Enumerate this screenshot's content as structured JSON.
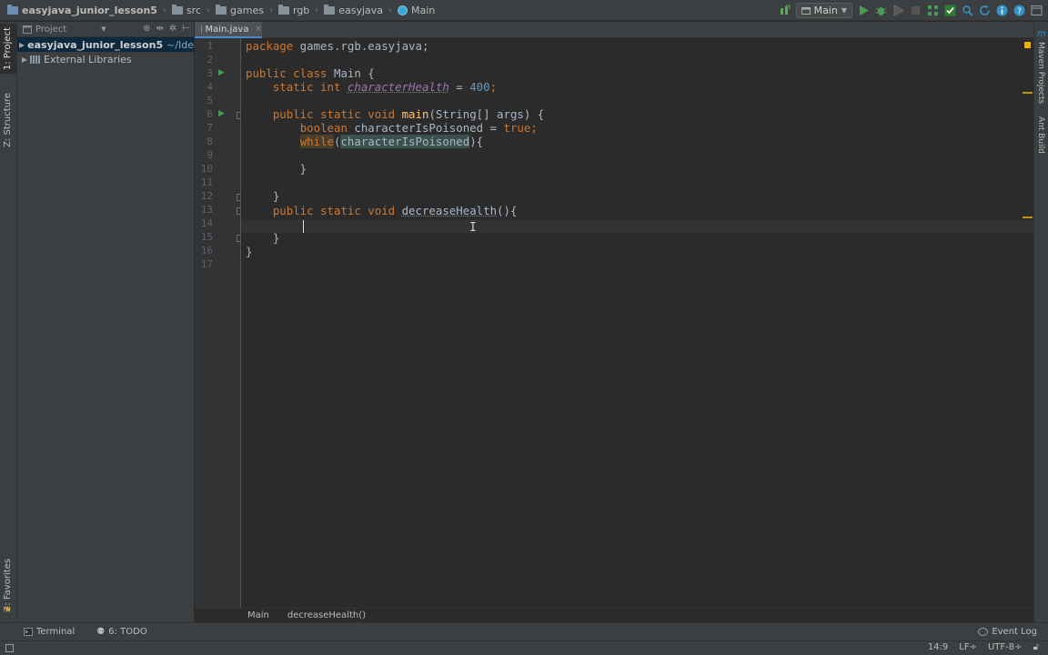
{
  "navbar": {
    "breadcrumbs": [
      {
        "label": "easyjava_junior_lesson5",
        "icon": "project-folder-icon"
      },
      {
        "label": "src",
        "icon": "folder-icon"
      },
      {
        "label": "games",
        "icon": "folder-icon"
      },
      {
        "label": "rgb",
        "icon": "folder-icon"
      },
      {
        "label": "easyjava",
        "icon": "folder-icon"
      },
      {
        "label": "Main",
        "icon": "class-icon"
      }
    ],
    "run_config": "Main"
  },
  "left_strip": {
    "tabs": [
      "1: Project",
      "Z: Structure",
      "2: Favorites"
    ]
  },
  "project_panel": {
    "header": "Project",
    "tree": [
      {
        "label": "easyjava_junior_lesson5",
        "path": "~/Idea",
        "expanded": false
      },
      {
        "label": "External Libraries",
        "expanded": false
      }
    ]
  },
  "editor": {
    "tab": "Main.java",
    "line_numbers": [
      "1",
      "2",
      "3",
      "4",
      "5",
      "6",
      "7",
      "8",
      "9",
      "10",
      "11",
      "12",
      "13",
      "14",
      "15",
      "16",
      "17"
    ],
    "code": {
      "l1_kw": "package",
      "l1_rest": " games.rgb.easyjava;",
      "l3_kw": "public class",
      "l3_rest": " Main {",
      "l4_indent": "    ",
      "l4_kw": "static int",
      "l4_space": " ",
      "l4_field": "characterHealth",
      "l4_eq": " = ",
      "l4_num": "400",
      "l4_semi": ";",
      "l6_indent": "    ",
      "l6_kw": "public static void",
      "l6_space": " ",
      "l6_method": "main",
      "l6_rest": "(String[] args) {",
      "l7_indent": "        ",
      "l7_kw": "boolean",
      "l7_mid": " characterIsPoisoned = ",
      "l7_val": "true",
      "l7_semi": ";",
      "l8_indent": "        ",
      "l8_kw": "while",
      "l8_p1": "(",
      "l8_var": "characterIsPoisoned",
      "l8_p2": "){",
      "l10": "        }",
      "l12": "    }",
      "l13_indent": "    ",
      "l13_kw": "public static void",
      "l13_space": " ",
      "l13_method": "decreaseHealth",
      "l13_rest": "(){",
      "l15": "    }",
      "l16": "}"
    }
  },
  "right_strip": {
    "tabs": [
      "Maven Projects",
      "Ant Build"
    ]
  },
  "code_breadcrumbs": [
    "Main",
    "decreaseHealth()"
  ],
  "bottom_bar": {
    "terminal": "Terminal",
    "todo": "6: TODO",
    "event_log": "Event Log"
  },
  "status_bar": {
    "position": "14:9",
    "line_sep": "LF÷",
    "encoding": "UTF-8÷"
  },
  "colors": {
    "keyword": "#cc7832",
    "number": "#6897bb",
    "field": "#9876aa",
    "method": "#ffc66d",
    "text": "#a9b7c6",
    "background": "#2b2b2b"
  }
}
